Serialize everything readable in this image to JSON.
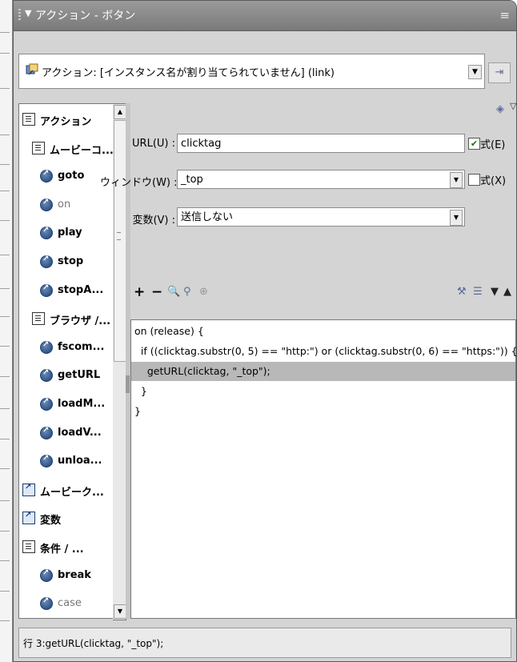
{
  "panel": {
    "title": "アクション - ボタン"
  },
  "action_bar": {
    "text": "アクション: [インスタンス名が割り当てられていません] (link)"
  },
  "tree": {
    "items": [
      {
        "label": "アクション",
        "level": 0,
        "icon": "book-icon"
      },
      {
        "label": "ムービーコ...",
        "level": 1,
        "icon": "book-icon"
      },
      {
        "label": "goto",
        "level": 2,
        "icon": "action-icon"
      },
      {
        "label": "on",
        "level": 2,
        "icon": "action-icon",
        "dim": true
      },
      {
        "label": "play",
        "level": 2,
        "icon": "action-icon"
      },
      {
        "label": "stop",
        "level": 2,
        "icon": "action-icon"
      },
      {
        "label": "stopA...",
        "level": 2,
        "icon": "action-icon"
      },
      {
        "label": "ブラウザ /...",
        "level": 1,
        "icon": "book-icon"
      },
      {
        "label": "fscom...",
        "level": 2,
        "icon": "action-icon"
      },
      {
        "label": "getURL",
        "level": 2,
        "icon": "action-icon"
      },
      {
        "label": "loadM...",
        "level": 2,
        "icon": "action-icon"
      },
      {
        "label": "loadV...",
        "level": 2,
        "icon": "action-icon"
      },
      {
        "label": "unloa...",
        "level": 2,
        "icon": "action-icon"
      },
      {
        "label": "ムービーク...",
        "level": 0,
        "icon": "book-arrow-icon"
      },
      {
        "label": "変数",
        "level": 0,
        "icon": "book-arrow-icon"
      },
      {
        "label": "条件 / ...",
        "level": 0,
        "icon": "book-icon"
      },
      {
        "label": "break",
        "level": 2,
        "icon": "action-icon"
      },
      {
        "label": "case",
        "level": 2,
        "icon": "action-icon",
        "dim": true
      }
    ]
  },
  "form": {
    "url_label": "URL(U) :",
    "url_value": "clicktag",
    "url_expr_label": "式(E)",
    "url_expr_checked": true,
    "window_label": "ウィンドウ(W) :",
    "window_value": "_top",
    "window_expr_label": "式(X)",
    "window_expr_checked": false,
    "vars_label": "変数(V) :",
    "vars_value": "送信しない"
  },
  "toolbar": {
    "add": "+",
    "remove": "−"
  },
  "code": {
    "lines": [
      "on (release) {",
      "  if ((clicktag.substr(0, 5) == \"http:\") or (clicktag.substr(0, 6) == \"https:\")) {",
      "    getURL(clicktag, \"_top\");",
      "  }",
      "}"
    ],
    "highlight_line": 3
  },
  "status": {
    "text": "行 3:getURL(clicktag, \"_top\");"
  }
}
